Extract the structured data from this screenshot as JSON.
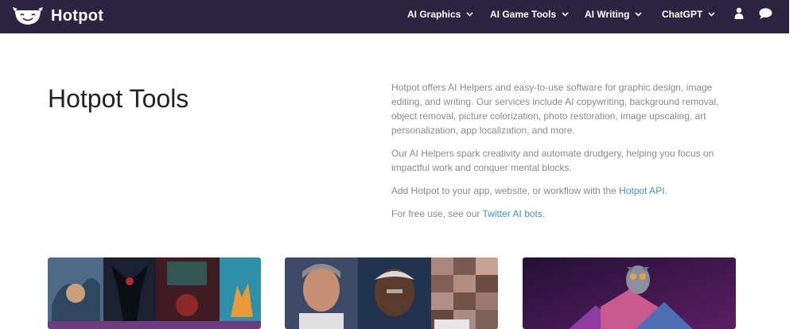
{
  "brand": {
    "name": "Hotpot"
  },
  "nav": {
    "items": [
      {
        "label": "AI Graphics"
      },
      {
        "label": "AI Game Tools"
      },
      {
        "label": "AI Writing"
      },
      {
        "label": "ChatGPT"
      }
    ],
    "icons": [
      "user-icon",
      "chat-bubble-icon"
    ]
  },
  "page": {
    "title": "Hotpot Tools",
    "intro": {
      "p1": "Hotpot offers AI Helpers and easy-to-use software for graphic design, image editing, and writing. Our services include AI copywriting, background removal, object removal, picture colorization, photo restoration, image upscaling, art personalization, app localization, and more.",
      "p2": "Our AI Helpers spark creativity and automate drudgery, helping you focus on impactful work and conquer mental blocks.",
      "p3_prefix": "Add Hotpot to your app, website, or workflow with the ",
      "p3_link": "Hotpot API",
      "p3_suffix": ".",
      "p4_prefix": "For free use, see our ",
      "p4_link": "Twitter AI bots",
      "p4_suffix": "."
    }
  },
  "cards": [
    {
      "name": "ai-art-collage"
    },
    {
      "name": "portrait-restoration-collage"
    },
    {
      "name": "ai-design-art"
    }
  ],
  "colors": {
    "nav_bg": "#2c2440",
    "link": "#3f92d2",
    "body_text": "#8a8a8a",
    "title": "#222222"
  }
}
